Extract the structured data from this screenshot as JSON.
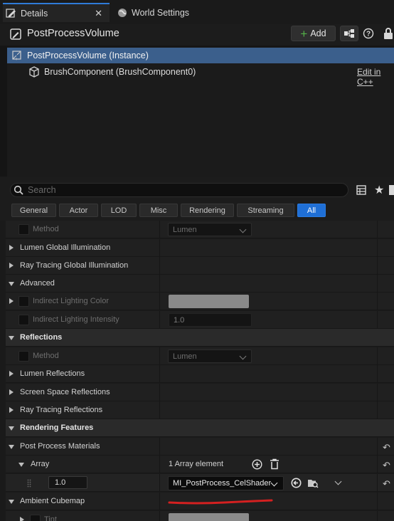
{
  "tabs": [
    {
      "label": "Details",
      "icon": "pencil-icon",
      "active": true
    },
    {
      "label": "World Settings",
      "icon": "globe-icon",
      "active": false
    }
  ],
  "header": {
    "title": "PostProcessVolume",
    "add_label": "Add"
  },
  "tree": [
    {
      "label": "PostProcessVolume (Instance)",
      "selected": true
    },
    {
      "label": "BrushComponent (BrushComponent0)",
      "link": "Edit in C++"
    }
  ],
  "search": {
    "placeholder": "Search"
  },
  "filters": [
    "General",
    "Actor",
    "LOD",
    "Misc",
    "Rendering",
    "Streaming",
    "All"
  ],
  "active_filter": "All",
  "properties": {
    "method1": {
      "label": "Method",
      "value": "Lumen"
    },
    "lumen_gi": "Lumen Global Illumination",
    "rt_gi": "Ray Tracing Global Illumination",
    "advanced": "Advanced",
    "indirect_color": "Indirect Lighting Color",
    "indirect_intensity": {
      "label": "Indirect Lighting Intensity",
      "value": "1.0"
    },
    "reflections": "Reflections",
    "method2": {
      "label": "Method",
      "value": "Lumen"
    },
    "lumen_reflections": "Lumen Reflections",
    "ss_reflections": "Screen Space Reflections",
    "rt_reflections": "Ray Tracing Reflections",
    "rendering_features": "Rendering Features",
    "pp_materials": "Post Process Materials",
    "array": {
      "label": "Array",
      "value": "1 Array element"
    },
    "element": {
      "weight": "1.0",
      "material": "MI_PostProcess_CelShader"
    },
    "ambient_cubemap": "Ambient Cubemap",
    "tint": "Tint"
  },
  "colors": {
    "accent": "#1f6fd6",
    "selection": "#3b5f8c",
    "annotation": "#d42020"
  }
}
